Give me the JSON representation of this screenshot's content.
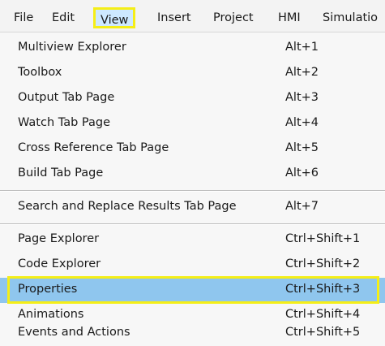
{
  "menubar": {
    "items": [
      {
        "label": "File"
      },
      {
        "label": "Edit"
      },
      {
        "label": "View"
      },
      {
        "label": "Insert"
      },
      {
        "label": "Project"
      },
      {
        "label": "HMI"
      },
      {
        "label": "Simulatio"
      }
    ]
  },
  "view_menu": {
    "items": [
      {
        "label": "Multiview Explorer",
        "shortcut": "Alt+1"
      },
      {
        "label": "Toolbox",
        "shortcut": "Alt+2"
      },
      {
        "label": "Output Tab Page",
        "shortcut": "Alt+3"
      },
      {
        "label": "Watch Tab Page",
        "shortcut": "Alt+4"
      },
      {
        "label": "Cross Reference Tab Page",
        "shortcut": "Alt+5"
      },
      {
        "label": "Build Tab Page",
        "shortcut": "Alt+6"
      },
      {
        "label": "Search and Replace Results Tab Page",
        "shortcut": "Alt+7"
      },
      {
        "label": "Page Explorer",
        "shortcut": "Ctrl+Shift+1"
      },
      {
        "label": "Code Explorer",
        "shortcut": "Ctrl+Shift+2"
      },
      {
        "label": "Properties",
        "shortcut": "Ctrl+Shift+3"
      },
      {
        "label": "Animations",
        "shortcut": "Ctrl+Shift+4"
      },
      {
        "label": "Events and Actions",
        "shortcut": "Ctrl+Shift+5"
      }
    ]
  }
}
